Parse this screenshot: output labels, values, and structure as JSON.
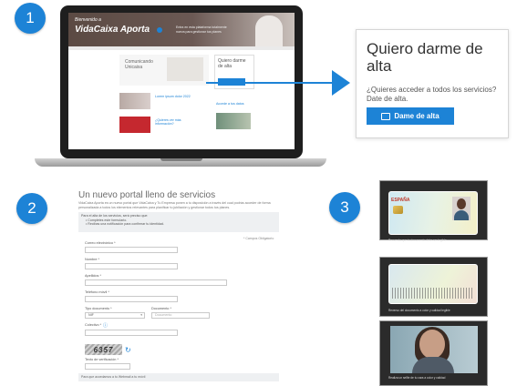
{
  "steps": {
    "one": "1",
    "two": "2",
    "three": "3"
  },
  "laptop": {
    "hero_small": "Bienvenido a",
    "brand": "VidaCaixa Aporta",
    "hero_tag": "Entra en esta plataforma totalmente nueva para gestionar tus planes",
    "col_title": "Comunicando Unicaixa",
    "box_title": "Quiero darme de alta",
    "box_button": "Dame de alta",
    "link_1": "Lorem ipsum dolor 2022",
    "link_2": "¿Quieres ver más información?",
    "link_3": "Accede a tus datos"
  },
  "popup": {
    "title": "Quiero darme de alta",
    "subtitle": "¿Quieres acceder a todos los servicios? Date de alta.",
    "button": "Dame de alta"
  },
  "form": {
    "heading": "Un nuevo portal lleno de servicios",
    "intro": "VidaCaixa Aporta es un nuevo portal que VidaCaixa y Tu Empresa ponen a tu disposición a través del cual podrás acceder de forma personalizada a todos los elementos relevantes para planificar tu jubilación y gestionar todos tus planes.",
    "notice_title": "Para el alta de los servicios, será preciso que:",
    "notice_1": "• Completes este formulario.",
    "notice_2": "• Recibas una notificación para confirmar tu identidad.",
    "required_note": "* Campos Obligatorio",
    "labels": {
      "email": "Correo electrónico *",
      "name": "Nombre *",
      "surname": "Apellidos *",
      "phone": "Teléfono móvil *",
      "doc_type": "Tipo documento *",
      "doc_number": "Documento *",
      "code": "Colectivo *",
      "verify": "Texto de verificación *"
    },
    "doc_type_value": "NIF",
    "doc_placeholder": "Documento",
    "captcha": "6357",
    "footer": "Para que accedamos a tu Webmail a tu móvil"
  },
  "ids": {
    "espana": "ESPAÑA",
    "caption_1": "Recuerda que tu documento debe ser legible",
    "caption_2": "Reverso del documento a color y calidad legible",
    "caption_3": "Realiza un selfie de tu cara a color y calidad"
  },
  "colors": {
    "accent": "#1d83d6"
  }
}
